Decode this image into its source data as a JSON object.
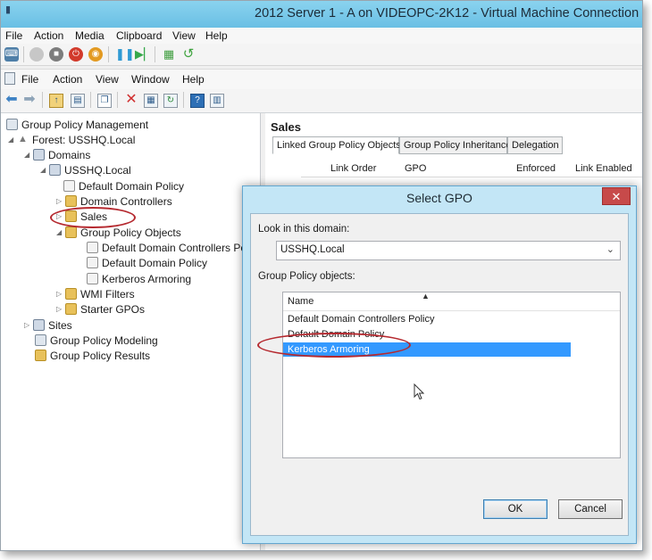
{
  "vm_window": {
    "title": "2012 Server 1 - A on VIDEOPC-2K12 - Virtual Machine Connection",
    "menu": [
      "File",
      "Action",
      "Media",
      "Clipboard",
      "View",
      "Help"
    ]
  },
  "mmc": {
    "menu": [
      "File",
      "Action",
      "View",
      "Window",
      "Help"
    ]
  },
  "tree": {
    "items": [
      {
        "label": "Group Policy Management",
        "icon": "gpm-icon"
      },
      {
        "label": "Forest: USSHQ.Local",
        "icon": "forest-icon"
      },
      {
        "label": "Domains",
        "icon": "domains-icon"
      },
      {
        "label": "USSHQ.Local",
        "icon": "domain-icon"
      },
      {
        "label": "Default Domain Policy",
        "icon": "gpo-link-icon"
      },
      {
        "label": "Domain Controllers",
        "icon": "ou-icon"
      },
      {
        "label": "Sales",
        "icon": "ou-icon"
      },
      {
        "label": "Group Policy Objects",
        "icon": "folder-icon"
      },
      {
        "label": "Default Domain Controllers Po",
        "icon": "gpo-icon"
      },
      {
        "label": "Default Domain Policy",
        "icon": "gpo-icon"
      },
      {
        "label": "Kerberos Armoring",
        "icon": "gpo-icon"
      },
      {
        "label": "WMI Filters",
        "icon": "folder-icon"
      },
      {
        "label": "Starter GPOs",
        "icon": "folder-icon"
      },
      {
        "label": "Sites",
        "icon": "sites-icon"
      },
      {
        "label": "Group Policy Modeling",
        "icon": "modeling-icon"
      },
      {
        "label": "Group Policy Results",
        "icon": "results-icon"
      }
    ]
  },
  "right_pane": {
    "title": "Sales",
    "tabs": [
      "Linked Group Policy Objects",
      "Group Policy Inheritance",
      "Delegation"
    ],
    "columns": [
      "Link Order",
      "GPO",
      "Enforced",
      "Link Enabled"
    ]
  },
  "dialog": {
    "title": "Select GPO",
    "close_label": "✕",
    "look_in_label": "Look in this domain:",
    "domain_value": "USSHQ.Local",
    "objects_label": "Group Policy objects:",
    "list_header": "Name",
    "items": [
      "Default Domain Controllers Policy",
      "Default Domain Policy",
      "Kerberos Armoring"
    ],
    "selected_index": 2,
    "ok_label": "OK",
    "cancel_label": "Cancel"
  },
  "colors": {
    "titlebar": "#7ccbec",
    "selection": "#3399ff",
    "highlight_ring": "#b5292f",
    "close_button": "#c74a4a"
  }
}
